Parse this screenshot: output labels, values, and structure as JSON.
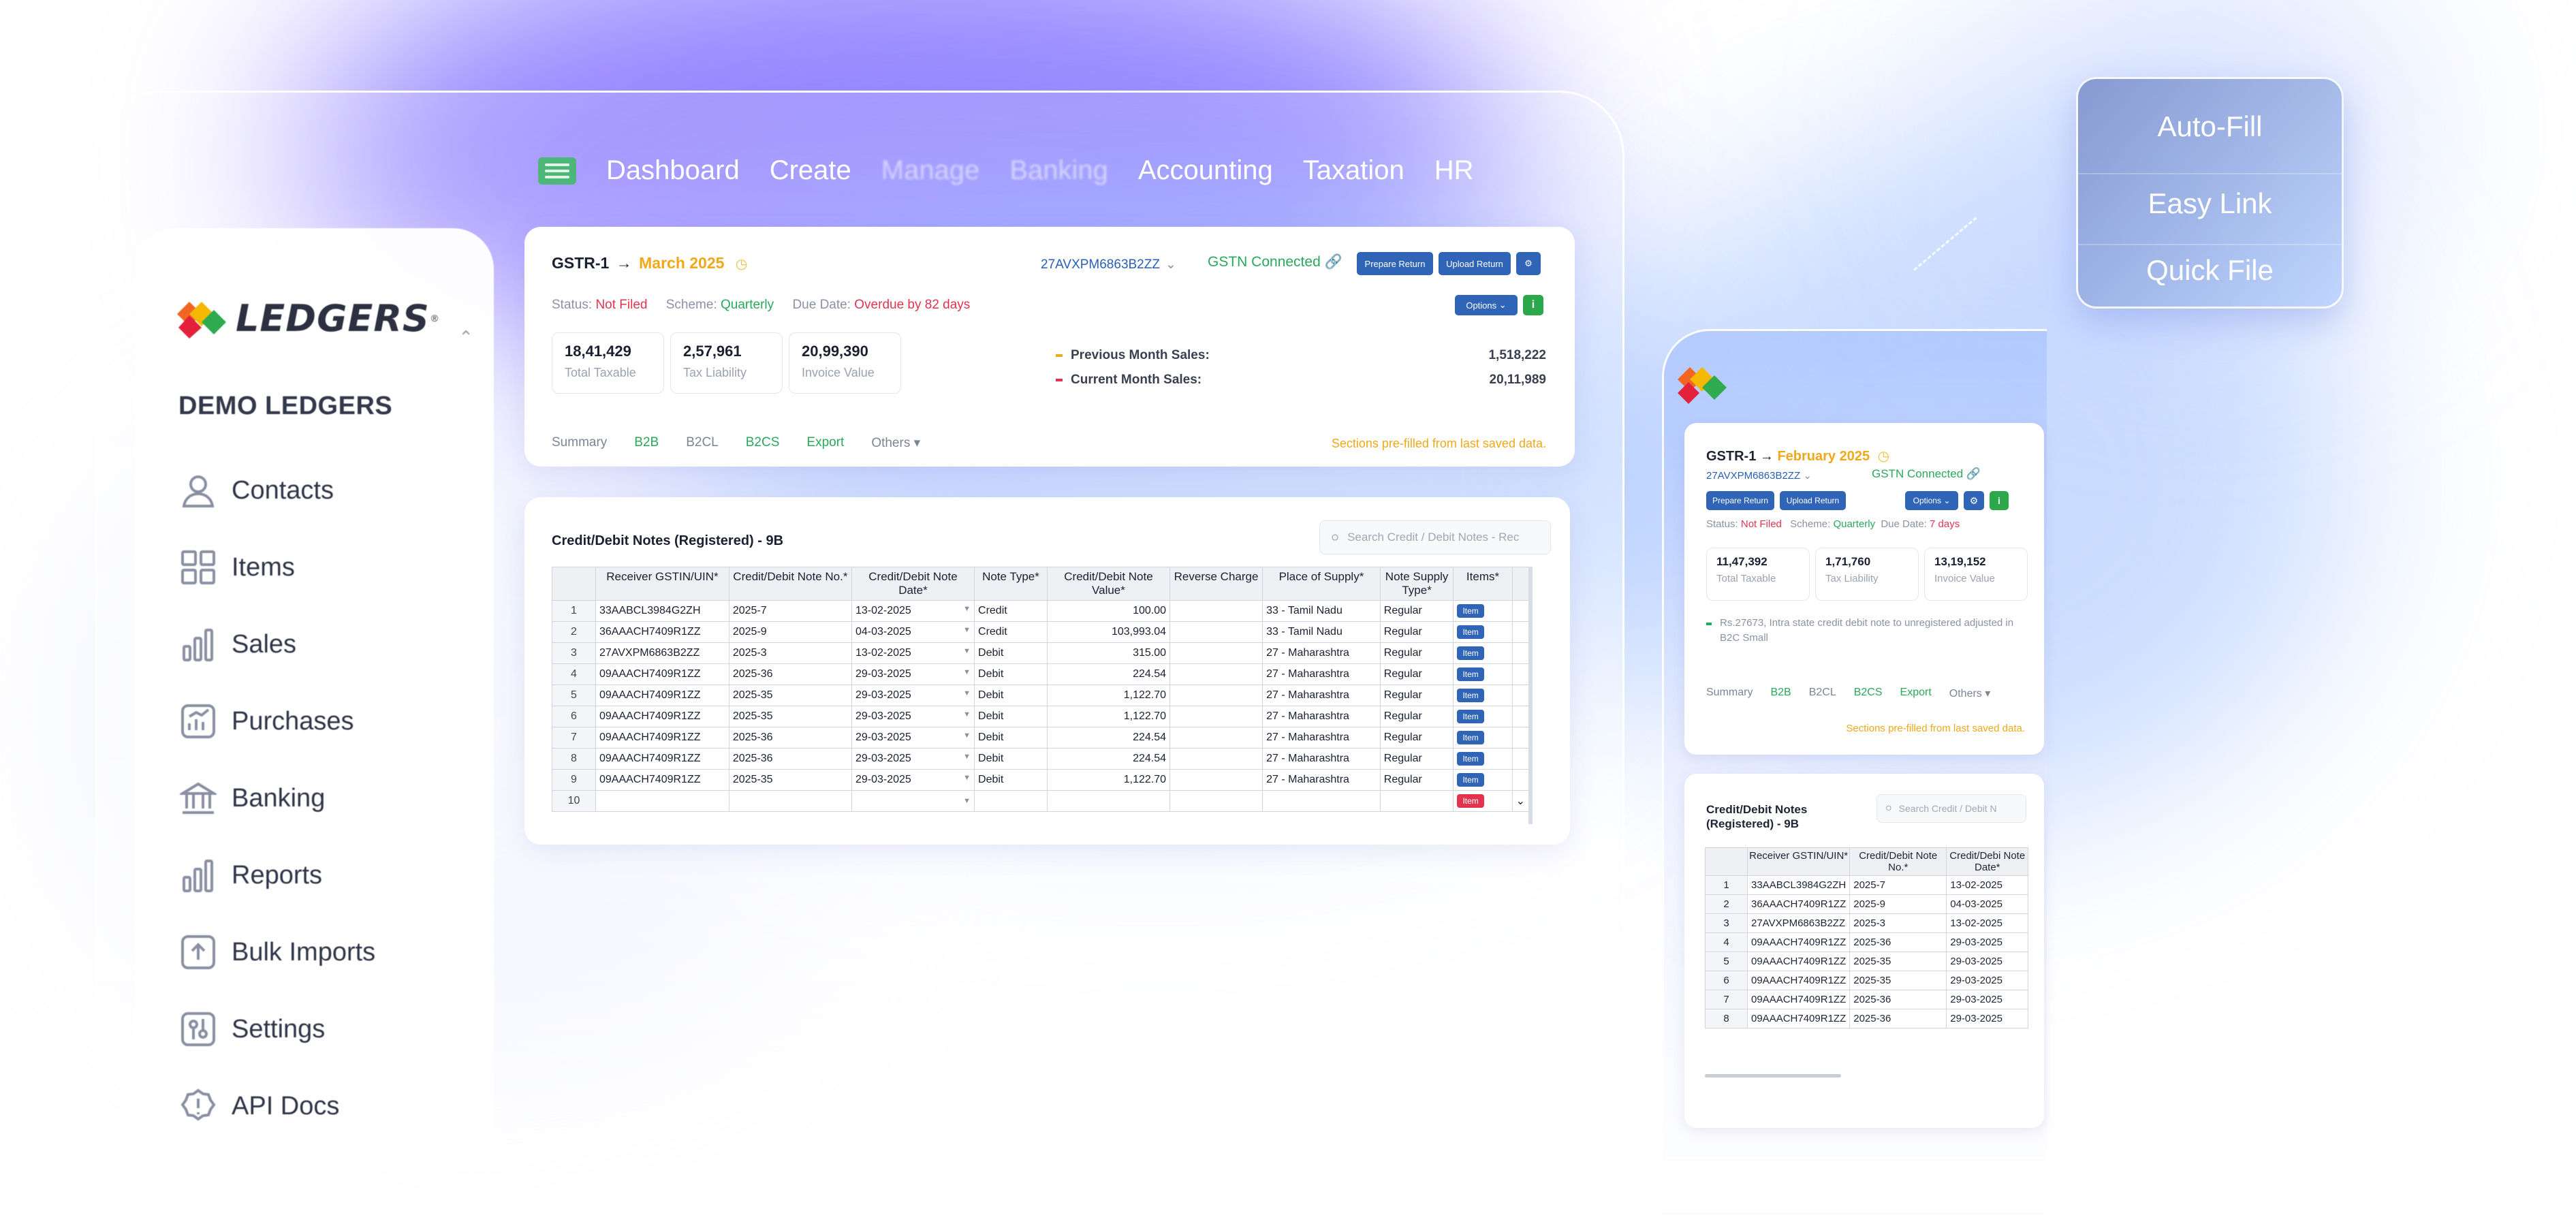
{
  "nav": {
    "items": [
      "Dashboard",
      "Create",
      "Manage",
      "Banking",
      "Accounting",
      "Taxation",
      "HR"
    ]
  },
  "sidebar": {
    "logo_text": "LEDGERS",
    "reg_mark": "®",
    "company": "DEMO LEDGERS",
    "items": [
      {
        "label": "Contacts",
        "icon": "user-icon"
      },
      {
        "label": "Items",
        "icon": "grid-icon"
      },
      {
        "label": "Sales",
        "icon": "bar-chart-icon"
      },
      {
        "label": "Purchases",
        "icon": "chart-up-icon"
      },
      {
        "label": "Banking",
        "icon": "bank-icon"
      },
      {
        "label": "Reports",
        "icon": "reports-icon"
      },
      {
        "label": "Bulk Imports",
        "icon": "upload-icon"
      },
      {
        "label": "Settings",
        "icon": "settings-icon"
      },
      {
        "label": "API Docs",
        "icon": "alert-icon"
      }
    ]
  },
  "gstr": {
    "title": "GSTR-1",
    "arrow": "→",
    "month": "March 2025",
    "gstin": "27AVXPM6863B2ZZ",
    "connected": "GSTN Connected",
    "prepare_label": "Prepare Return",
    "upload_label": "Upload Return",
    "options_label": "Options",
    "info_label": "i",
    "status_label": "Status:",
    "status_value": "Not Filed",
    "scheme_label": "Scheme:",
    "scheme_value": "Quarterly",
    "due_label": "Due Date:",
    "due_value": "Overdue by 82 days",
    "stats": [
      {
        "value": "18,41,429",
        "caption": "Total Taxable"
      },
      {
        "value": "2,57,961",
        "caption": "Tax Liability"
      },
      {
        "value": "20,99,390",
        "caption": "Invoice Value"
      }
    ],
    "prev_sales_label": "Previous Month Sales:",
    "prev_sales_value": "1,518,222",
    "curr_sales_label": "Current Month Sales:",
    "curr_sales_value": "20,11,989",
    "tabs": [
      "Summary",
      "B2B",
      "B2CL",
      "B2CS",
      "Export",
      "Others ▾"
    ],
    "prefill_note": "Sections pre-filled from last saved data."
  },
  "table": {
    "title": "Credit/Debit Notes (Registered) - 9B",
    "search_placeholder": "Search Credit / Debit Notes - Rec",
    "headers": [
      "Receiver GSTIN/UIN*",
      "Credit/Debit Note No.*",
      "Credit/Debit Note Date*",
      "Note Type*",
      "Credit/Debit Note Value*",
      "Reverse Charge",
      "Place of Supply*",
      "Note Supply Type*",
      "Items*"
    ],
    "item_label": "Item",
    "rows": [
      {
        "n": "1",
        "gstin": "33AABCL3984G2ZH",
        "no": "2025-7",
        "date": "13-02-2025",
        "type": "Credit",
        "value": "100.00",
        "rc": "",
        "pos": "33 - Tamil Nadu",
        "st": "Regular"
      },
      {
        "n": "2",
        "gstin": "36AAACH7409R1ZZ",
        "no": "2025-9",
        "date": "04-03-2025",
        "type": "Credit",
        "value": "103,993.04",
        "rc": "",
        "pos": "33 - Tamil Nadu",
        "st": "Regular"
      },
      {
        "n": "3",
        "gstin": "27AVXPM6863B2ZZ",
        "no": "2025-3",
        "date": "13-02-2025",
        "type": "Debit",
        "value": "315.00",
        "rc": "",
        "pos": "27 - Maharashtra",
        "st": "Regular"
      },
      {
        "n": "4",
        "gstin": "09AAACH7409R1ZZ",
        "no": "2025-36",
        "date": "29-03-2025",
        "type": "Debit",
        "value": "224.54",
        "rc": "",
        "pos": "27 - Maharashtra",
        "st": "Regular"
      },
      {
        "n": "5",
        "gstin": "09AAACH7409R1ZZ",
        "no": "2025-35",
        "date": "29-03-2025",
        "type": "Debit",
        "value": "1,122.70",
        "rc": "",
        "pos": "27 - Maharashtra",
        "st": "Regular"
      },
      {
        "n": "6",
        "gstin": "09AAACH7409R1ZZ",
        "no": "2025-35",
        "date": "29-03-2025",
        "type": "Debit",
        "value": "1,122.70",
        "rc": "",
        "pos": "27 - Maharashtra",
        "st": "Regular"
      },
      {
        "n": "7",
        "gstin": "09AAACH7409R1ZZ",
        "no": "2025-36",
        "date": "29-03-2025",
        "type": "Debit",
        "value": "224.54",
        "rc": "",
        "pos": "27 - Maharashtra",
        "st": "Regular"
      },
      {
        "n": "8",
        "gstin": "09AAACH7409R1ZZ",
        "no": "2025-36",
        "date": "29-03-2025",
        "type": "Debit",
        "value": "224.54",
        "rc": "",
        "pos": "27 - Maharashtra",
        "st": "Regular"
      },
      {
        "n": "9",
        "gstin": "09AAACH7409R1ZZ",
        "no": "2025-35",
        "date": "29-03-2025",
        "type": "Debit",
        "value": "1,122.70",
        "rc": "",
        "pos": "27 - Maharashtra",
        "st": "Regular"
      },
      {
        "n": "10",
        "gstin": "",
        "no": "",
        "date": "",
        "type": "",
        "value": "",
        "rc": "",
        "pos": "",
        "st": ""
      }
    ]
  },
  "badges": [
    "Auto-Fill",
    "Easy Link",
    "Quick File"
  ],
  "mobile": {
    "title": "GSTR-1",
    "arrow": "→",
    "month": "February 2025",
    "gstin": "27AVXPM6863B2ZZ",
    "connected": "GSTN Connected",
    "prepare_label": "Prepare Return",
    "upload_label": "Upload Return",
    "options_label": "Options",
    "info_label": "i",
    "status_label": "Status:",
    "status_value": "Not Filed",
    "scheme_label": "Scheme:",
    "scheme_value": "Quarterly",
    "due_label": "Due Date:",
    "due_value": "7 days",
    "stats": [
      {
        "value": "11,47,392",
        "caption": "Total Taxable"
      },
      {
        "value": "1,71,760",
        "caption": "Tax Liability"
      },
      {
        "value": "13,19,152",
        "caption": "Invoice Value"
      }
    ],
    "note": "Rs.27673, Intra state credit debit note to unregistered adjusted in B2C Small",
    "tabs": [
      "Summary",
      "B2B",
      "B2CL",
      "B2CS",
      "Export",
      "Others ▾"
    ],
    "prefill_note": "Sections pre-filled from last saved data.",
    "table_title_1": "Credit/Debit Notes",
    "table_title_2": "(Registered) - 9B",
    "search_placeholder": "Search Credit / Debit N",
    "headers": [
      "Receiver GSTIN/UIN*",
      "Credit/Debit Note No.*",
      "Credit/Debi Note Date*"
    ],
    "rows": [
      {
        "n": "1",
        "gstin": "33AABCL3984G2ZH",
        "no": "2025-7",
        "date": "13-02-2025"
      },
      {
        "n": "2",
        "gstin": "36AAACH7409R1ZZ",
        "no": "2025-9",
        "date": "04-03-2025"
      },
      {
        "n": "3",
        "gstin": "27AVXPM6863B2ZZ",
        "no": "2025-3",
        "date": "13-02-2025"
      },
      {
        "n": "4",
        "gstin": "09AAACH7409R1ZZ",
        "no": "2025-36",
        "date": "29-03-2025"
      },
      {
        "n": "5",
        "gstin": "09AAACH7409R1ZZ",
        "no": "2025-35",
        "date": "29-03-2025"
      },
      {
        "n": "6",
        "gstin": "09AAACH7409R1ZZ",
        "no": "2025-35",
        "date": "29-03-2025"
      },
      {
        "n": "7",
        "gstin": "09AAACH7409R1ZZ",
        "no": "2025-36",
        "date": "29-03-2025"
      },
      {
        "n": "8",
        "gstin": "09AAACH7409R1ZZ",
        "no": "2025-36",
        "date": "29-03-2025"
      }
    ]
  },
  "colors": {
    "accent_green": "#2aa85a",
    "accent_blue": "#2f64b6",
    "warning_orange": "#f0a81a",
    "danger_red": "#e2344e"
  }
}
